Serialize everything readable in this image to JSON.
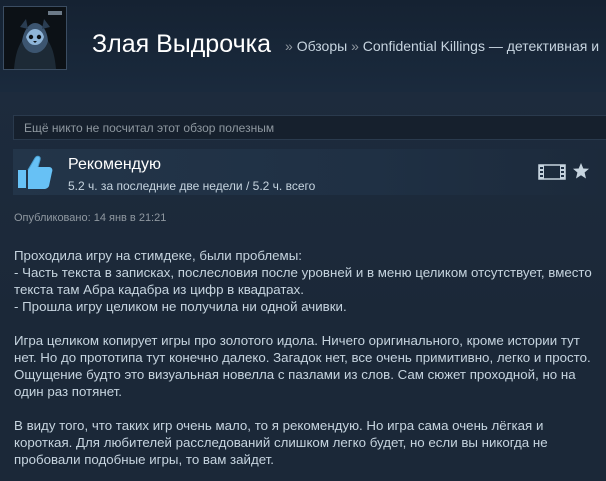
{
  "header": {
    "persona_name": "Злая Выдрочка",
    "separator": "»",
    "breadcrumb_reviews": "Обзоры",
    "breadcrumb_game": "Confidential Killings — детективная и"
  },
  "review": {
    "helpful_text": "Ещё никто не посчитал этот обзор полезным",
    "recommendation": "Рекомендую",
    "hours": "5.2 ч. за последние две недели / 5.2 ч. всего",
    "posted": "Опубликовано: 14 янв в 21:21",
    "paragraphs": [
      "Проходила игру на стимдеке, были проблемы:\n- Часть текста в записках, послесловия после уровней и в меню целиком отсутствует, вместо текста там Абра кадабра из цифр в квадратах.\n- Прошла игру целиком не получила ни одной ачивки.",
      "Игра целиком копирует игры про золотого идола. Ничего оригинального, кроме истории тут нет. Но до прототипа тут конечно далеко. Загадок нет, все очень примитивно, легко и просто. Ощущение будто это визуальная новелла с пазлами из слов. Сам сюжет проходной, но на один раз потянет.",
      "В виду того, что таких игр очень мало, то я рекомендую. Но игра сама очень лёгкая и короткая. Для любителей расследований слишком легко будет, но если вы никогда не пробовали подобные игры, то вам зайдет."
    ]
  },
  "icons": {
    "avatar": "avatar-image",
    "thumb": "thumbs-up-icon",
    "film": "film-strip-icon",
    "star": "star-icon"
  },
  "colors": {
    "background": "#1b2838",
    "thumb_blue": "#67c1f5",
    "title_white": "#ffffff",
    "muted": "#8f98a0"
  }
}
